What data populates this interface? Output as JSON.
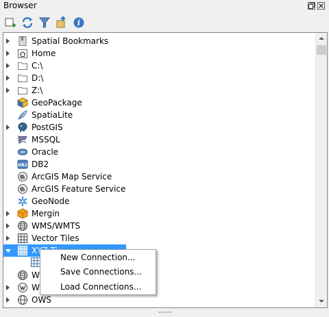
{
  "panel": {
    "title": "Browser"
  },
  "toolbar": {
    "buttons": [
      {
        "icon": "add-layer-icon"
      },
      {
        "icon": "refresh-icon"
      },
      {
        "icon": "filter-icon"
      },
      {
        "icon": "collapse-all-icon"
      },
      {
        "icon": "info-icon"
      }
    ]
  },
  "tree": {
    "items": [
      {
        "label": "Spatial Bookmarks",
        "icon": "bookmark-icon",
        "expandable": true
      },
      {
        "label": "Home",
        "icon": "home-folder-icon",
        "expandable": true
      },
      {
        "label": "C:\\",
        "icon": "folder-icon",
        "expandable": true
      },
      {
        "label": "D:\\",
        "icon": "folder-icon",
        "expandable": true
      },
      {
        "label": "Z:\\",
        "icon": "folder-icon",
        "expandable": true
      },
      {
        "label": "GeoPackage",
        "icon": "geopackage-icon",
        "expandable": false
      },
      {
        "label": "SpatiaLite",
        "icon": "spatialite-icon",
        "expandable": false
      },
      {
        "label": "PostGIS",
        "icon": "postgis-icon",
        "expandable": true
      },
      {
        "label": "MSSQL",
        "icon": "mssql-icon",
        "expandable": false
      },
      {
        "label": "Oracle",
        "icon": "oracle-icon",
        "expandable": false
      },
      {
        "label": "DB2",
        "icon": "db2-icon",
        "expandable": false
      },
      {
        "label": "ArcGIS Map Service",
        "icon": "arcgis-map-icon",
        "expandable": false
      },
      {
        "label": "ArcGIS Feature Service",
        "icon": "arcgis-feature-icon",
        "expandable": false
      },
      {
        "label": "GeoNode",
        "icon": "geonode-icon",
        "expandable": false
      },
      {
        "label": "Mergin",
        "icon": "mergin-icon",
        "expandable": true
      },
      {
        "label": "WMS/WMTS",
        "icon": "wms-icon",
        "expandable": true
      },
      {
        "label": "Vector Tiles",
        "icon": "vector-tiles-icon",
        "expandable": true
      },
      {
        "label": "XYZ Tiles",
        "icon": "xyz-tiles-icon",
        "expandable": true,
        "expanded": true,
        "selected": true
      },
      {
        "label": "WCS",
        "icon": "wcs-icon",
        "expandable": false
      },
      {
        "label": "WFS",
        "icon": "wfs-icon",
        "expandable": true
      },
      {
        "label": "OWS",
        "icon": "ows-icon",
        "expandable": true
      }
    ],
    "visible_labels": {
      "xyz": "XYZ Ti",
      "wcs": "WC",
      "wfs": "WF"
    }
  },
  "context_menu": {
    "items": [
      {
        "label": "New Connection..."
      },
      {
        "label": "Save Connections..."
      },
      {
        "label": "Load Connections..."
      }
    ]
  },
  "colors": {
    "selection": "#3399ff",
    "panel_bg": "#ffffff",
    "window_bg": "#f0f0f0"
  }
}
